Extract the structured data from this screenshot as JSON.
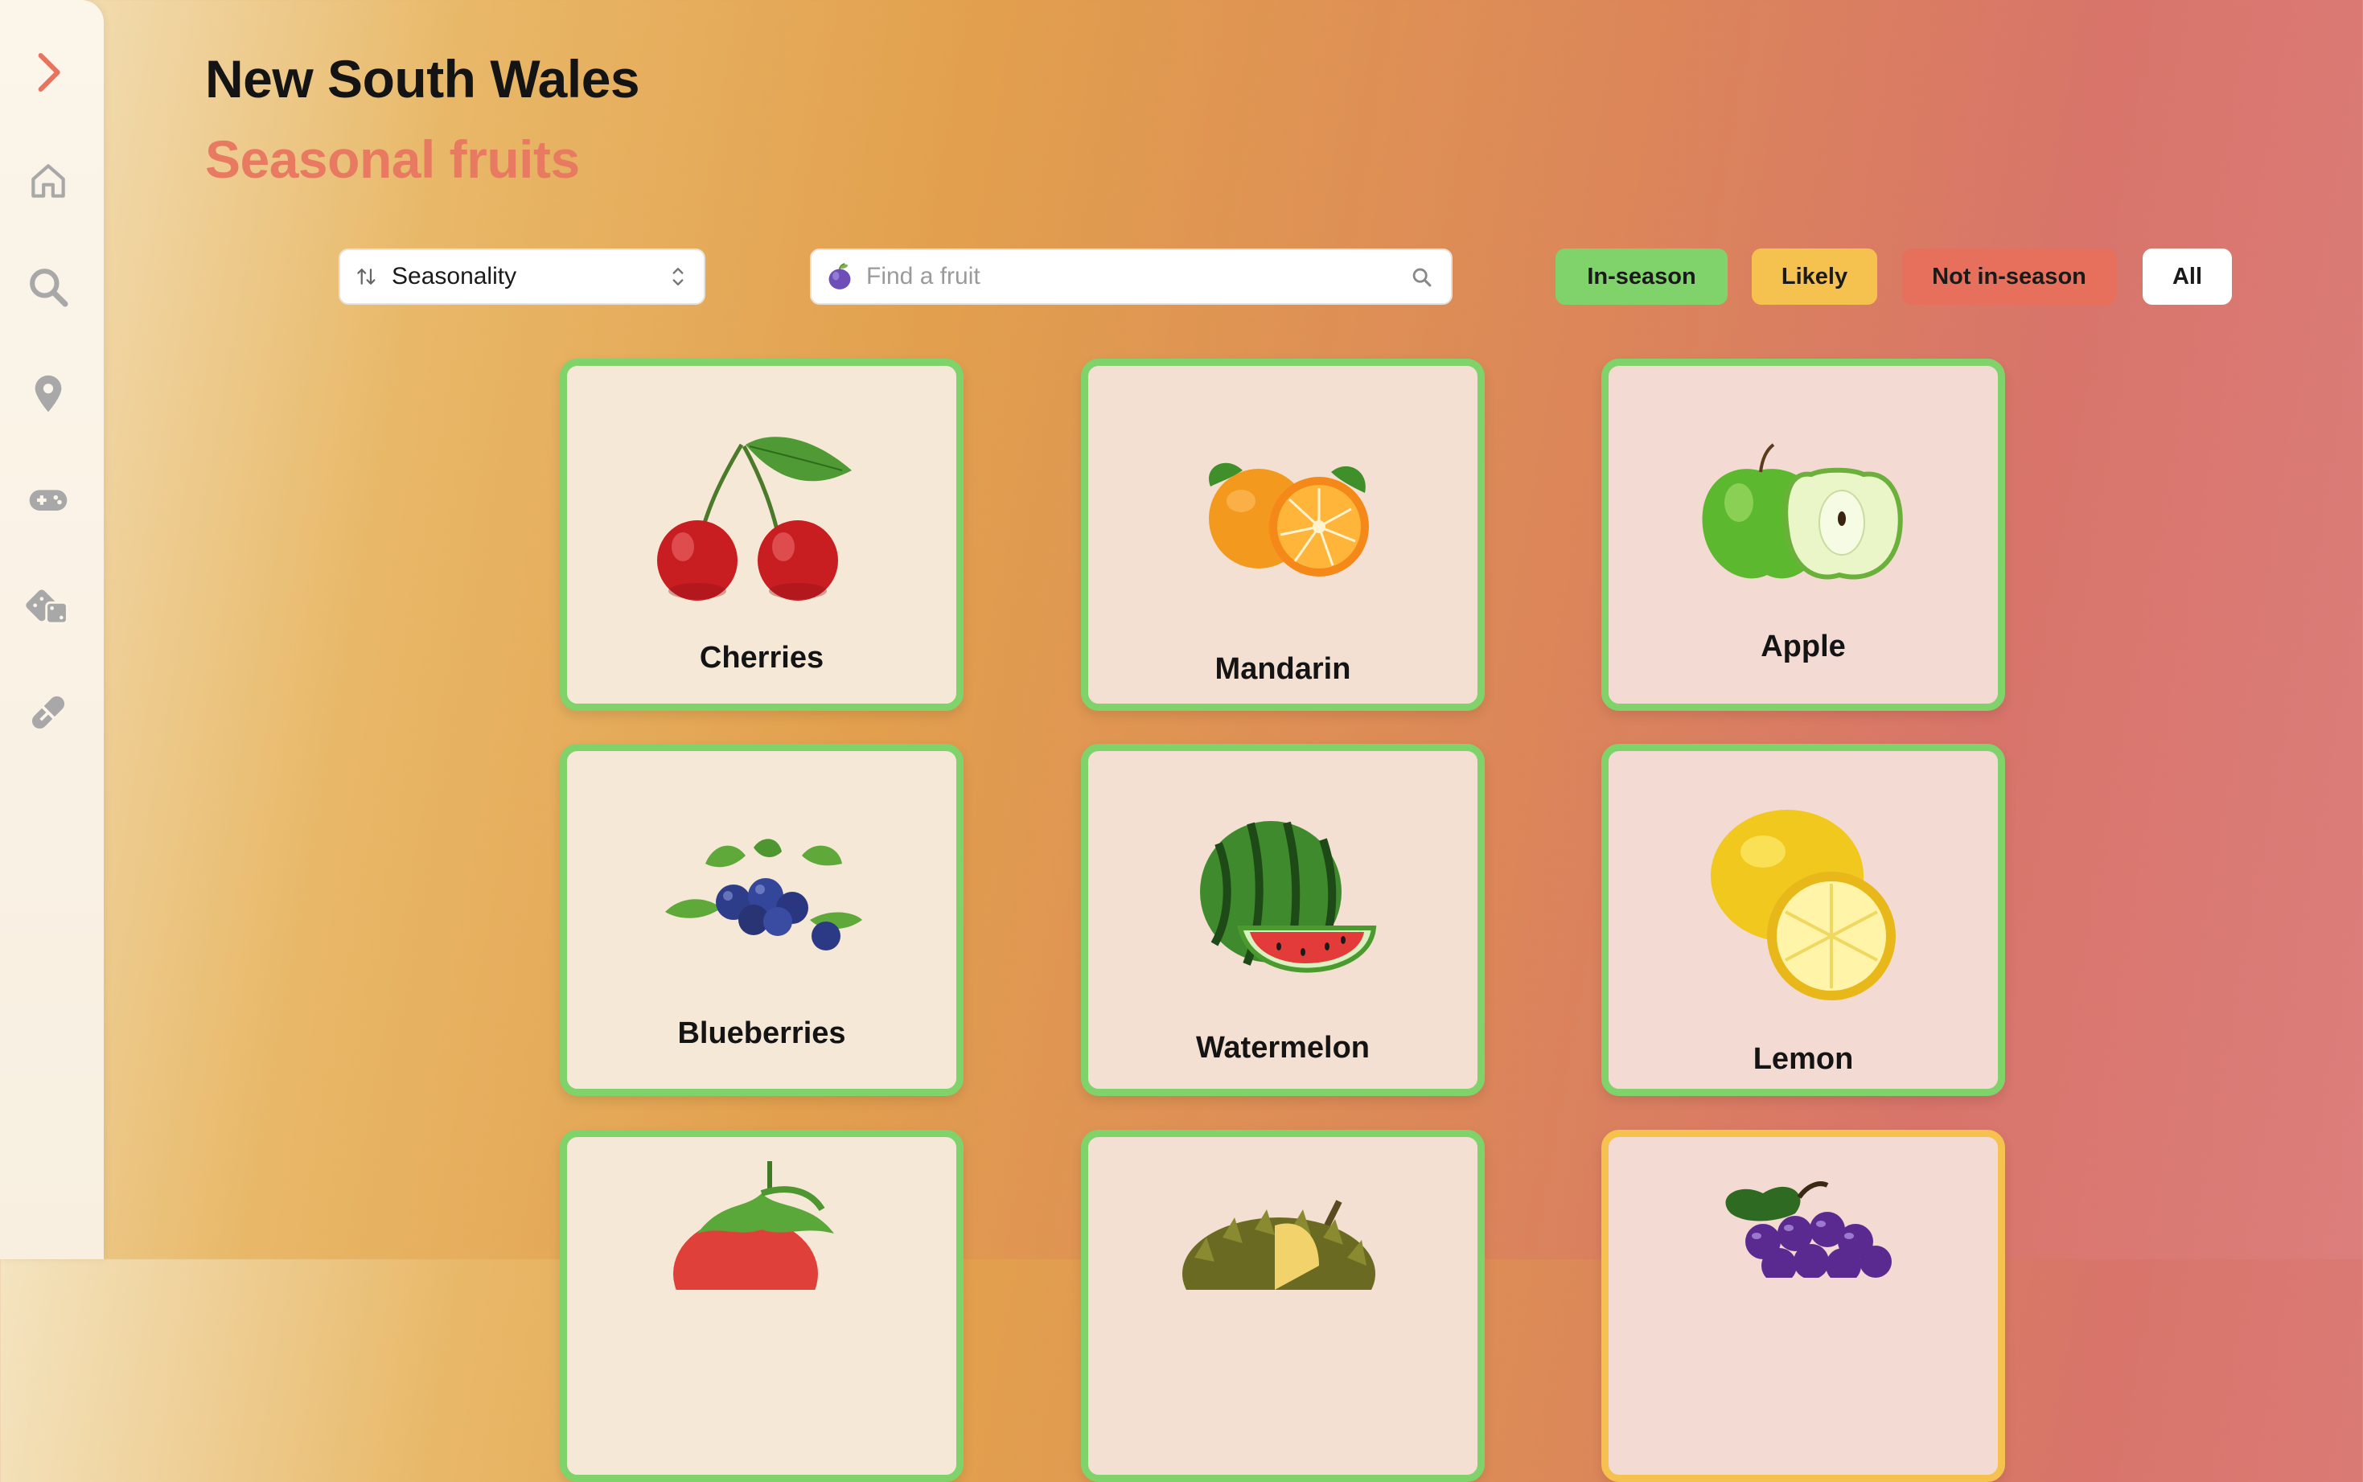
{
  "header": {
    "title": "New South Wales",
    "subtitle": "Seasonal fruits"
  },
  "sidebar": {
    "items": [
      {
        "icon": "chevron-right-icon"
      },
      {
        "icon": "home-icon"
      },
      {
        "icon": "search-icon"
      },
      {
        "icon": "location-pin-icon"
      },
      {
        "icon": "gamepad-icon"
      },
      {
        "icon": "dice-icon"
      },
      {
        "icon": "pill-icon"
      }
    ]
  },
  "controls": {
    "sort": {
      "selected": "Seasonality"
    },
    "search": {
      "placeholder": "Find a fruit",
      "value": ""
    },
    "filters": [
      {
        "label": "In-season",
        "color": "#7fd36a"
      },
      {
        "label": "Likely",
        "color": "#f5c24f"
      },
      {
        "label": "Not in-season",
        "color": "#e6705c"
      },
      {
        "label": "All",
        "color": "#ffffff"
      }
    ]
  },
  "fruits": [
    {
      "name": "Cherries",
      "status": "In-season",
      "icon": "cherries-image"
    },
    {
      "name": "Mandarin",
      "status": "In-season",
      "icon": "mandarin-image"
    },
    {
      "name": "Apple",
      "status": "In-season",
      "icon": "apple-image"
    },
    {
      "name": "Blueberries",
      "status": "In-season",
      "icon": "blueberries-image"
    },
    {
      "name": "Watermelon",
      "status": "In-season",
      "icon": "watermelon-image"
    },
    {
      "name": "Lemon",
      "status": "In-season",
      "icon": "lemon-image"
    },
    {
      "name": "",
      "status": "In-season",
      "icon": "strawberry-image"
    },
    {
      "name": "",
      "status": "In-season",
      "icon": "durian-image"
    },
    {
      "name": "",
      "status": "Likely",
      "icon": "grapes-image"
    }
  ]
}
